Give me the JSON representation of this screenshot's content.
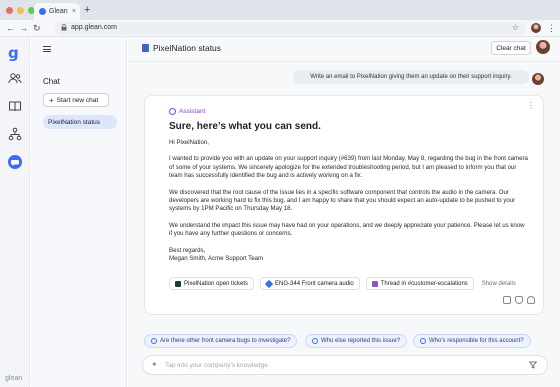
{
  "browser": {
    "tab_title": "Glean",
    "tab_close": "×",
    "new_tab": "+",
    "url": "app.glean.com",
    "nav_back": "←",
    "nav_forward": "→",
    "nav_reload": "↻",
    "star": "☆",
    "menu": "⋮",
    "lock": "🔒"
  },
  "rail": {
    "logo": "g",
    "brand": "glean"
  },
  "sidebar": {
    "title": "Chat",
    "new_chat_icon": "+",
    "new_chat_label": "Start new chat",
    "items": [
      {
        "label": "PixelNation status",
        "active": true
      }
    ]
  },
  "header": {
    "title": "PixelNation status",
    "clear_label": "Clear chat"
  },
  "conversation": {
    "user_message": "Write an email to PixelNation giving them an update on their support inquiry.",
    "assistant_label": "Assistant",
    "assistant_heading": "Sure, here’s what you can send.",
    "email": {
      "greeting": "Hi PixelNation,",
      "p1": "I wanted to provide you with an update on your support inquiry (#639) from last Monday, May 8, regarding the bug in the front camera of some of your systems. We sincerely apologize for the extended troubleshooting period, but I am pleased to inform you that our team has successfully identified the bug and is actively working on a fix.",
      "p2": "We discovered that the root cause of the issue lies in a specific software component that controls the audio in the camera. Our developers are working hard to fix this bug, and I am happy to share that you should expect an auto-update to be pushed to your systems by 1PM Pacific on Thursday May 18.",
      "p3": "We understand the impact this issue may have had on your operations, and we deeply appreciate your patience. Please let us know if you have any further questions or concerns.",
      "closing": "Best regards,",
      "signature": "Megan Smith, Acme Support Team"
    },
    "sources": [
      {
        "label": "PixelNation open tickets",
        "icon": "zendesk-icon",
        "color": "#1f3a3d"
      },
      {
        "label": "ENG-344 Front camera audio",
        "icon": "jira-icon",
        "color": "#2f74e8"
      },
      {
        "label": "Thread in #customer-escalations",
        "icon": "slack-icon",
        "color": "#8a5ac4"
      }
    ],
    "show_details": "Show details",
    "card_more": "⋮"
  },
  "suggestions": [
    "Are there other front camera bugs to investigate?",
    "Who else reported this issue?",
    "Who’s responsible for this account?"
  ],
  "input": {
    "placeholder": "Tap into your company’s knowledge",
    "icon": "✦"
  },
  "colors": {
    "accent": "#3d6bf4",
    "assistant": "#8b3dd6",
    "active_item": "#dde6fb"
  }
}
